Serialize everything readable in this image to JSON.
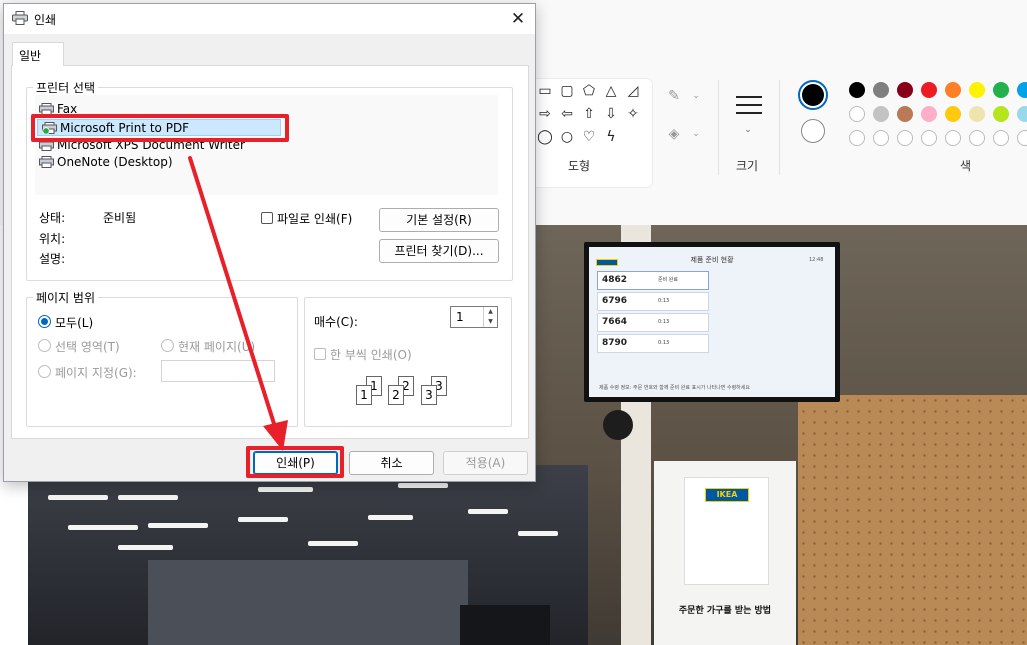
{
  "paint": {
    "groups": {
      "shapes_label": "도형",
      "size_label": "크기",
      "colors_label": "색"
    },
    "colors": [
      "#000000",
      "#7f7f7f",
      "#880015",
      "#ed1c24",
      "#ff7f27",
      "#fff200",
      "#22b14c",
      "#00a2e8",
      "#ffffff",
      "#c3c3c3",
      "#b97a57",
      "#ffaec9",
      "#ffc90e",
      "#efe4b0",
      "#b5e61d",
      "#99d9ea"
    ]
  },
  "photo": {
    "tv": {
      "title": "제품 준비 현황",
      "clock": "12:48",
      "rows": [
        {
          "number": "4862",
          "status": "준비 완료"
        },
        {
          "number": "6796",
          "status": "0:13"
        },
        {
          "number": "7664",
          "status": "0:13"
        },
        {
          "number": "8790",
          "status": "0:13"
        }
      ],
      "footer": "제품 수령 정보: 주문 번호와 함께 준비 완료 표시가 나타나면 수령하세요"
    },
    "board": {
      "logo": "IKEA",
      "heading": "주문한 가구를 받는 방법"
    }
  },
  "dialog": {
    "title": "인쇄",
    "close_glyph": "✕",
    "tab": "일반",
    "printer_section": {
      "legend": "프린터 선택",
      "printers": [
        "Fax",
        "Microsoft Print to PDF",
        "Microsoft XPS Document Writer",
        "OneNote (Desktop)"
      ],
      "selected": "Microsoft Print to PDF"
    },
    "status": {
      "status_label": "상태:",
      "status_value": "준비됨",
      "location_label": "위치:",
      "comment_label": "설명:"
    },
    "print_to_file_label": "파일로 인쇄(F)",
    "preferences_button": "기본 설정(R)",
    "find_printer_button": "프린터 찾기(D)...",
    "page_range": {
      "legend": "페이지 범위",
      "all": "모두(L)",
      "selection": "선택 영역(T)",
      "current_page": "현재 페이지(U)",
      "pages": "페이지 지정(G):",
      "selected_option": "all"
    },
    "copies": {
      "label": "매수(C):",
      "value": "1",
      "collate_label": "한 부씩 인쇄(O)"
    },
    "buttons": {
      "print": "인쇄(P)",
      "cancel": "취소",
      "apply": "적용(A)"
    }
  }
}
